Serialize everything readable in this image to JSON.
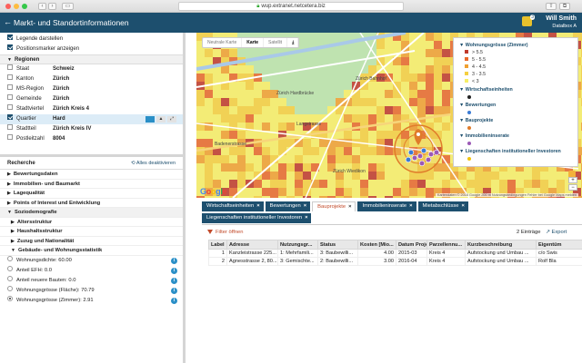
{
  "browser": {
    "url": "wup.extranet.netcetera.biz"
  },
  "app": {
    "title": "Markt- und Standortinformationen",
    "user_name": "Will Smith",
    "company": "Datalbox A",
    "notifications": "3"
  },
  "options": [
    {
      "label": "Legende darstellen",
      "checked": true
    },
    {
      "label": "Positionsmarker anzeigen",
      "checked": true
    }
  ],
  "regionen": {
    "header": "Regionen",
    "rows": [
      {
        "key": "Staat",
        "value": "Schweiz",
        "checked": false
      },
      {
        "key": "Kanton",
        "value": "Zürich",
        "checked": false
      },
      {
        "key": "MS-Region",
        "value": "Zürich",
        "checked": false
      },
      {
        "key": "Gemeinde",
        "value": "Zürich",
        "checked": false
      },
      {
        "key": "Stadtviertel",
        "value": "Zürich Kreis 4",
        "checked": false
      },
      {
        "key": "Quartier",
        "value": "Hard",
        "checked": true
      },
      {
        "key": "Stadtteil",
        "value": "Zürich Kreis IV",
        "checked": false
      },
      {
        "key": "Postleitzahl",
        "value": "8004",
        "checked": false
      }
    ]
  },
  "recherche": {
    "header": "Recherche",
    "deactivate_label": "Alles deaktivieren",
    "sections": [
      "Bewertungsdaten",
      "Immobilien- und Baumarkt",
      "Lagequalität",
      "Points of Interest und Entwicklung",
      "Soziodemografie"
    ],
    "sub_sections": [
      "Altersstruktur",
      "Haushaltsstruktur",
      "Zuzug und Nationalität",
      "Gebäude- und Wohnungsstatistik"
    ],
    "stats": [
      {
        "label": "Wohnungsdichte: 60.00",
        "selected": false
      },
      {
        "label": "Anteil EFH: 0.0",
        "selected": false
      },
      {
        "label": "Anteil neuere Bauten: 0.0",
        "selected": false
      },
      {
        "label": "Wohnungsgrösse (Fläche): 70.79",
        "selected": false
      },
      {
        "label": "Wohnungsgrösse (Zimmer): 2.91",
        "selected": true
      }
    ]
  },
  "map": {
    "types": [
      "Neutrale Karte",
      "Karte",
      "Satellit"
    ],
    "active_type": "Karte",
    "labels": {
      "bahnhof": "Zürich Bahnhof",
      "hardbruecke": "Zürich Hardbrücke",
      "wiedikon": "Zürich Wiedikon",
      "altstetten": "Albisrieden",
      "hardturm": "Hardturm",
      "badenerstrasse": "Badenerstrasse",
      "langstrasse": "Langstrasse",
      "stauffacher": "Stauffacher"
    },
    "google": "Google",
    "attribution": "Kartendaten © 2016 Google    200 m    Nutzungsbedingungen    Fehler bei Google Maps melden",
    "legend": {
      "title": "Wohnungsgrösse (Zimmer)",
      "classes": [
        {
          "label": "> 5.5",
          "color": "#c0392b"
        },
        {
          "label": "5 - 5.5",
          "color": "#e8692b"
        },
        {
          "label": "4 - 4.5",
          "color": "#f0a030"
        },
        {
          "label": "3 - 3.5",
          "color": "#f5cf40"
        },
        {
          "label": "< 3",
          "color": "#f7ef66"
        }
      ],
      "layers": [
        {
          "label": "Wirtschaftseinheiten",
          "color": "#222222"
        },
        {
          "label": "Bewertungen",
          "color": "#3b7bd4"
        },
        {
          "label": "Bauprojekte",
          "color": "#e07b2a"
        },
        {
          "label": "Immobilieninserate",
          "color": "#9b59b6"
        },
        {
          "label": "Liegenschaften institutioneller Investoren",
          "color": "#f1c40f"
        }
      ]
    }
  },
  "tabs": [
    {
      "label": "Wirtschaftseinheiten",
      "active": false
    },
    {
      "label": "Bewertungen",
      "active": false
    },
    {
      "label": "Bauprojekte",
      "active": true
    },
    {
      "label": "Immobilieninserate",
      "active": false
    },
    {
      "label": "Mietabschlüsse",
      "active": false
    },
    {
      "label": "Liegenschaften institutioneller Investoren",
      "active": false
    }
  ],
  "table": {
    "filter_label": "Filter öffnen",
    "count": "2 Einträge",
    "export_label": "Export",
    "columns": [
      "Label",
      "Adresse",
      "Nutzungsgr...",
      "Status",
      "Kosten [Mio...",
      "Datum Proje...",
      "Parzellennu...",
      "Kurzbeschreibung",
      "Eigentüm"
    ],
    "rows": [
      [
        "1",
        "Kanzleistrasse 225...",
        "1: Mehrfamili...",
        "3: Baubewilli...",
        "4.00",
        "2015-03",
        "Kreis 4",
        "Aufstockung und Umbau ...",
        "c/o Swis"
      ],
      [
        "2",
        "Agnesstrasse 2, 80...",
        "3: Gemischte...",
        "2: Baubewilli...",
        "3.00",
        "2016-04",
        "Kreis 4",
        "Aufstockung und Umbau ...",
        "Rolf Bla"
      ]
    ]
  }
}
